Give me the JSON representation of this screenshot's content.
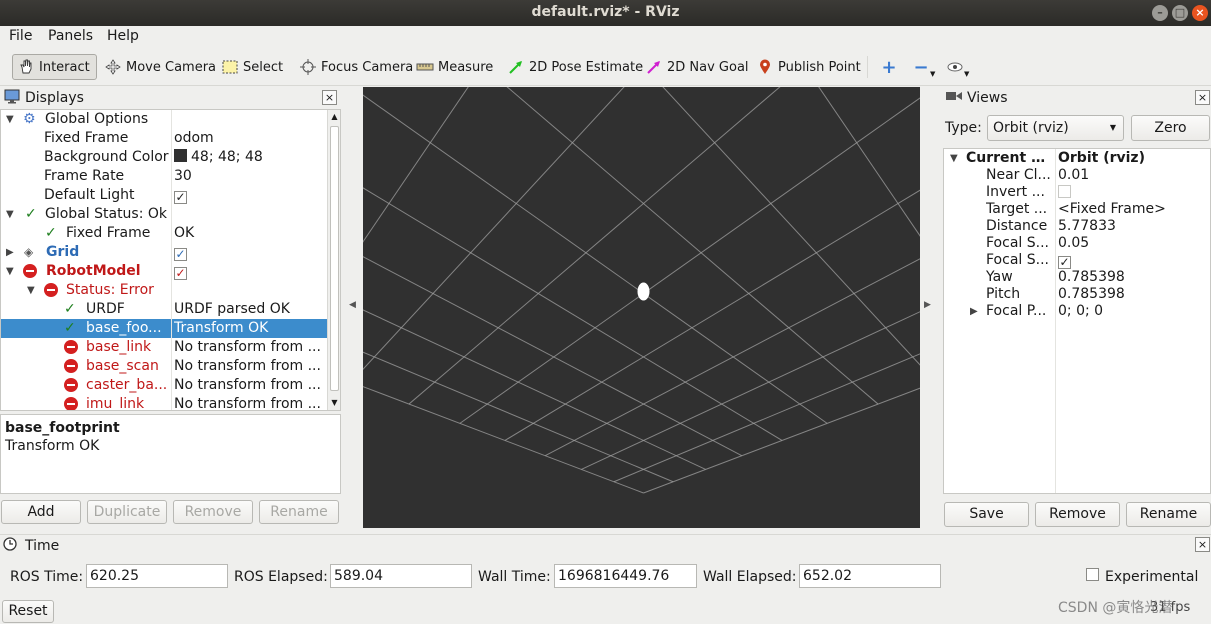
{
  "window": {
    "title": "default.rviz* - RViz"
  },
  "menu": {
    "file": "File",
    "panels": "Panels",
    "help": "Help"
  },
  "toolbar": {
    "interact": "Interact",
    "move_camera": "Move Camera",
    "select": "Select",
    "focus_camera": "Focus Camera",
    "measure": "Measure",
    "pose_estimate": "2D Pose Estimate",
    "nav_goal": "2D Nav Goal",
    "publish_point": "Publish Point"
  },
  "displays": {
    "title": "Displays",
    "rows": [
      {
        "name": "Global Options",
        "value": ""
      },
      {
        "name": "Fixed Frame",
        "value": "odom"
      },
      {
        "name": "Background Color",
        "value": "48; 48; 48"
      },
      {
        "name": "Frame Rate",
        "value": "30"
      },
      {
        "name": "Default Light",
        "value": ""
      },
      {
        "name": "Global Status: Ok",
        "value": ""
      },
      {
        "name": "Fixed Frame",
        "value": "OK"
      },
      {
        "name": "Grid",
        "value": ""
      },
      {
        "name": "RobotModel",
        "value": ""
      },
      {
        "name": "Status: Error",
        "value": ""
      },
      {
        "name": "URDF",
        "value": "URDF parsed OK"
      },
      {
        "name": "base_foo...",
        "value": "Transform OK"
      },
      {
        "name": "base_link",
        "value": "No transform from ..."
      },
      {
        "name": "base_scan",
        "value": "No transform from ..."
      },
      {
        "name": "caster_ba...",
        "value": "No transform from ..."
      },
      {
        "name": "imu_link",
        "value": "No transform from ..."
      }
    ],
    "desc_title": "base_footprint",
    "desc_text": "Transform OK",
    "buttons": {
      "add": "Add",
      "duplicate": "Duplicate",
      "remove": "Remove",
      "rename": "Rename"
    }
  },
  "views": {
    "title": "Views",
    "type_label": "Type:",
    "type_value": "Orbit (rviz)",
    "zero": "Zero",
    "rows": [
      {
        "name": "Current V...",
        "value": "Orbit (rviz)"
      },
      {
        "name": "Near Cl...",
        "value": "0.01"
      },
      {
        "name": "Invert ...",
        "value": ""
      },
      {
        "name": "Target ...",
        "value": "<Fixed Frame>"
      },
      {
        "name": "Distance",
        "value": "5.77833"
      },
      {
        "name": "Focal S...",
        "value": "0.05"
      },
      {
        "name": "Focal S...",
        "value": ""
      },
      {
        "name": "Yaw",
        "value": "0.785398"
      },
      {
        "name": "Pitch",
        "value": "0.785398"
      },
      {
        "name": "Focal P...",
        "value": "0; 0; 0"
      }
    ],
    "buttons": {
      "save": "Save",
      "remove": "Remove",
      "rename": "Rename"
    }
  },
  "time": {
    "title": "Time",
    "ros_time_label": "ROS Time:",
    "ros_time": "620.25",
    "ros_elapsed_label": "ROS Elapsed:",
    "ros_elapsed": "589.04",
    "wall_time_label": "Wall Time:",
    "wall_time": "1696816449.76",
    "wall_elapsed_label": "Wall Elapsed:",
    "wall_elapsed": "652.02",
    "experimental": "Experimental",
    "reset": "Reset",
    "fps": "31 fps",
    "watermark": "CSDN @寅恪光潜"
  },
  "colors": {
    "background": "#303030",
    "grid": "#a0a0a0",
    "selection": "#3c8ccc"
  }
}
